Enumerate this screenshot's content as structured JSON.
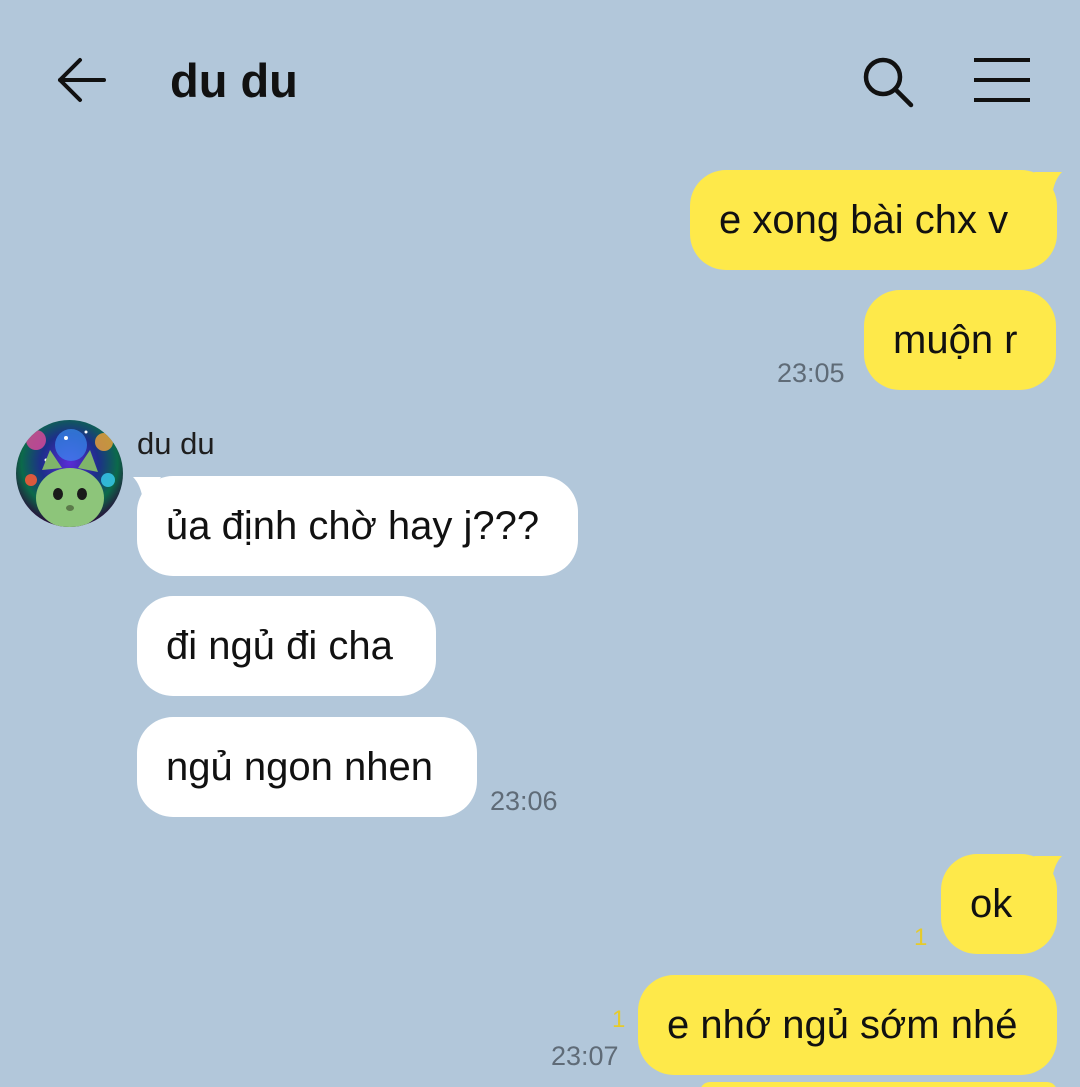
{
  "header": {
    "title": "du du",
    "back_icon": "arrow-left-icon",
    "search_icon": "search-icon",
    "menu_icon": "hamburger-menu-icon"
  },
  "colors": {
    "background": "#b2c7da",
    "outgoing_bubble": "#fee94a",
    "incoming_bubble": "#ffffff",
    "unread_count": "#e6cb2a"
  },
  "contact": {
    "name": "du du",
    "avatar_icon": "cat-avatar-image"
  },
  "messages": [
    {
      "direction": "outgoing",
      "text": "e xong bài chx v"
    },
    {
      "direction": "outgoing",
      "text": "muộn r",
      "time": "23:05"
    },
    {
      "direction": "incoming",
      "text": "ủa định chờ hay j???"
    },
    {
      "direction": "incoming",
      "text": "đi ngủ đi cha"
    },
    {
      "direction": "incoming",
      "text": "ngủ ngon nhen",
      "time": "23:06"
    },
    {
      "direction": "outgoing",
      "text": "ok",
      "unread": "1"
    },
    {
      "direction": "outgoing",
      "text": "e nhớ ngủ sớm nhé",
      "unread": "1",
      "time": "23:07"
    }
  ]
}
